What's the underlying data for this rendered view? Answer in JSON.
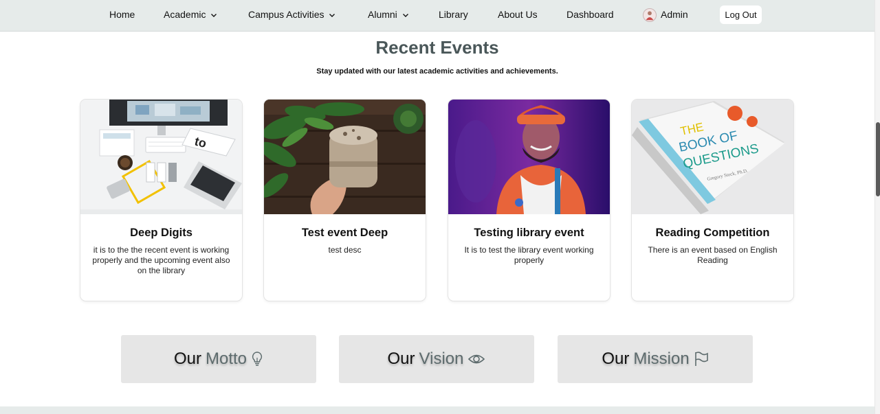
{
  "nav": {
    "home": "Home",
    "academic": "Academic",
    "campus_activities": "Campus Activities",
    "alumni": "Alumni",
    "library": "Library",
    "about_us": "About Us",
    "dashboard": "Dashboard",
    "admin": "Admin",
    "logout": "Log Out"
  },
  "events_section": {
    "title": "Recent Events",
    "subtitle": "Stay updated with our latest academic activities and achievements."
  },
  "events": [
    {
      "title": "Deep Digits",
      "description": "it is to the the recent event is working properly and the upcoming event also on the library",
      "image": "desk-workspace-photo"
    },
    {
      "title": "Test event Deep",
      "description": "test desc",
      "image": "hand-holding-smoothie-photo"
    },
    {
      "title": "Testing library event",
      "description": "It is to test the library event working properly",
      "image": "smiling-performer-photo"
    },
    {
      "title": "Reading Competition",
      "description": "There is an event based on English Reading",
      "image": "book-of-questions-photo"
    }
  ],
  "values": [
    {
      "word1": "Our",
      "word2": "Motto",
      "icon": "lightbulb-icon"
    },
    {
      "word1": "Our",
      "word2": "Vision",
      "icon": "eye-icon"
    },
    {
      "word1": "Our",
      "word2": "Mission",
      "icon": "flag-icon"
    }
  ],
  "colors": {
    "navbar_bg": "#e6ebea",
    "title": "#4a5759",
    "value_box_bg": "#e6e6e6",
    "value_accent": "#5d6b6d"
  }
}
